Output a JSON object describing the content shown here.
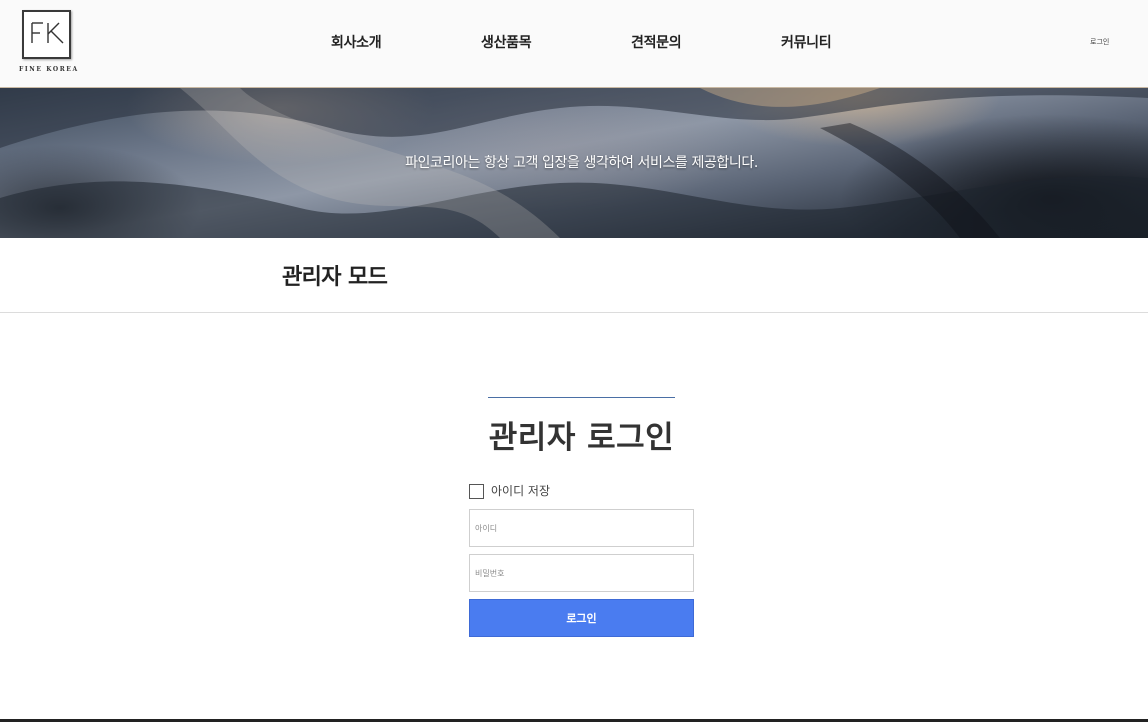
{
  "header": {
    "logo": {
      "monogram": "FK",
      "text": "FINE KOREA"
    },
    "nav": [
      {
        "label": "회사소개"
      },
      {
        "label": "생산품목"
      },
      {
        "label": "견적문의"
      },
      {
        "label": "커뮤니티"
      }
    ],
    "login_link": "로그인"
  },
  "banner": {
    "text": "파인코리아는 항상 고객 입장을 생각하여 서비스를 제공합니다."
  },
  "page_title": "관리자 모드",
  "login": {
    "heading": "관리자 로그인",
    "remember_label": "아이디 저장",
    "remember_checked": false,
    "id_placeholder": "아이디",
    "id_value": "",
    "password_placeholder": "비밀번호",
    "password_value": "",
    "submit_label": "로그인"
  },
  "colors": {
    "accent": "#4a7cf0",
    "divider_accent": "#4a6fa5",
    "header_bg": "#fafafa"
  }
}
